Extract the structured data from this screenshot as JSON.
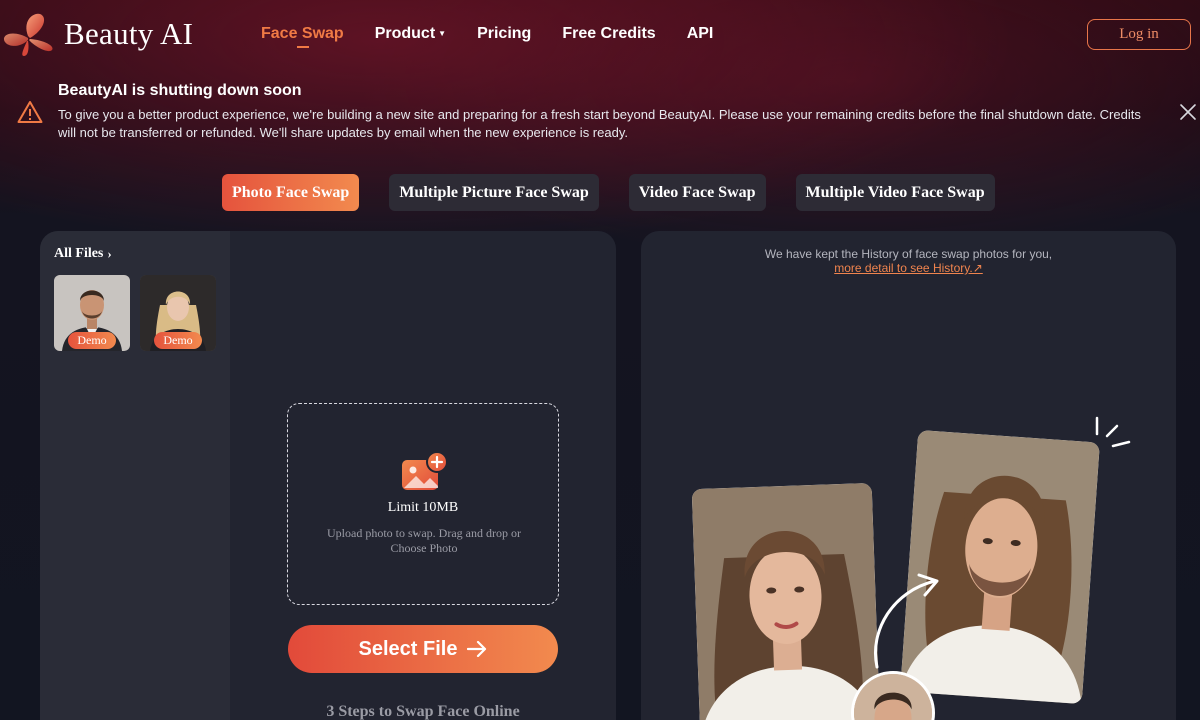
{
  "header": {
    "brand": "Beauty AI",
    "nav": [
      {
        "label": "Face Swap",
        "active": true,
        "has_dropdown": false
      },
      {
        "label": "Product",
        "active": false,
        "has_dropdown": true
      },
      {
        "label": "Pricing",
        "active": false,
        "has_dropdown": false
      },
      {
        "label": "Free Credits",
        "active": false,
        "has_dropdown": false
      },
      {
        "label": "API",
        "active": false,
        "has_dropdown": false
      }
    ],
    "login_label": "Log in"
  },
  "banner": {
    "title": "BeautyAI is shutting down soon",
    "message": "To give you a better product experience, we're building a new site and preparing for a fresh start beyond BeautyAI. Please use your remaining credits before the final shutdown date. Credits will not be transferred or refunded. We'll share updates by email when the new experience is ready.",
    "icon": "warning-triangle-icon"
  },
  "tabs": [
    {
      "label": "Photo Face Swap",
      "active": true
    },
    {
      "label": "Multiple Picture Face Swap",
      "active": false
    },
    {
      "label": "Video Face Swap",
      "active": false
    },
    {
      "label": "Multiple Video Face Swap",
      "active": false
    }
  ],
  "left_panel": {
    "all_files_label": "All Files",
    "files": [
      {
        "badge": "Demo",
        "subject": "man-in-suit"
      },
      {
        "badge": "Demo",
        "subject": "blonde-woman-in-suit"
      }
    ],
    "upload": {
      "limit": "Limit 10MB",
      "hint": "Upload photo to swap. Drag and drop or Choose Photo"
    },
    "select_file_label": "Select File",
    "steps_title": "3 Steps to Swap Face Online"
  },
  "right_panel": {
    "history_text": "We have kept the History of face swap photos for you,",
    "history_link": "more detail to see History.↗"
  },
  "colors": {
    "accent": "#f07a45",
    "accent_gradient_start": "#e5533d",
    "accent_gradient_end": "#f28a4e",
    "panel": "#222430",
    "tab_bg": "#2d2b35"
  }
}
